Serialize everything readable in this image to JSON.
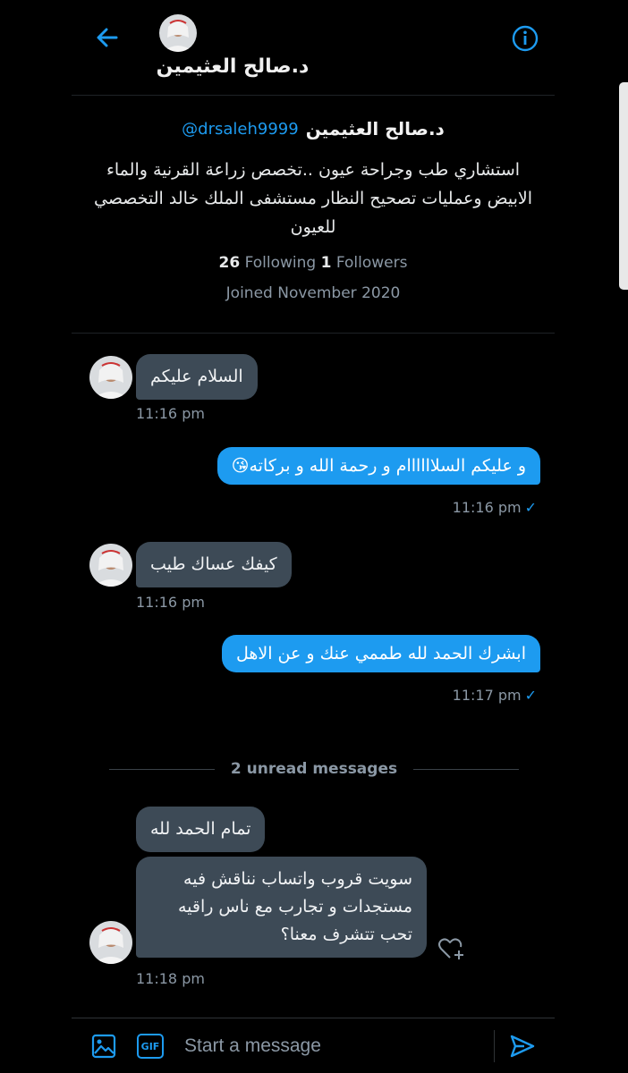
{
  "header": {
    "name": "د.صالح العثيمين",
    "back_icon": "back-arrow-icon",
    "info_icon": "info-icon"
  },
  "profile": {
    "name": "د.صالح العثيمين",
    "handle": "@drsaleh9999",
    "bio": "استشاري طب وجراحة عيون ..تخصص زراعة القرنية والماء الابيض وعمليات تصحيح النظار مستشفى الملك خالد التخصصي للعيون",
    "following_count": "26",
    "following_label": "Following",
    "followers_count": "1",
    "followers_label": "Followers",
    "joined": "Joined November 2020"
  },
  "messages": [
    {
      "direction": "in",
      "text": "السلام عليكم",
      "time": "11:16 pm"
    },
    {
      "direction": "out",
      "text": "و عليكم السلاااااام و رحمة الله و بركاته😘",
      "time": "11:16 pm"
    },
    {
      "direction": "in",
      "text": "كيفك عساك طيب",
      "time": "11:16 pm"
    },
    {
      "direction": "out",
      "text": "ابشرك الحمد لله طممي عنك و عن الاهل",
      "time": "11:17 pm"
    }
  ],
  "unread": {
    "label": "2 unread messages"
  },
  "unread_messages": [
    {
      "direction": "in",
      "text": "تمام الحمد لله"
    },
    {
      "direction": "in",
      "text": "سويت قروب واتساب نناقش فيه مستجدات و تجارب مع ناس راقيه تحب تتشرف معنا؟",
      "time": "11:18 pm"
    }
  ],
  "composer": {
    "placeholder": "Start a message",
    "gif_label": "GIF"
  },
  "colors": {
    "accent": "#1d9bf0",
    "incoming_bubble": "#3d4a56",
    "background": "#000000"
  }
}
